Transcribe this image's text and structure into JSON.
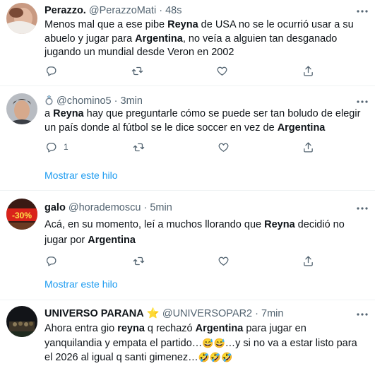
{
  "tweets": [
    {
      "name": "Perazzo.",
      "handle": "@PerazzoMati",
      "separator": "·",
      "time": "48s",
      "text": [
        "Menos mal que a ese pibe ",
        "Reyna",
        " de USA no se le ocurrió usar a su abuelo y jugar para ",
        "Argentina",
        ", no veía a alguien tan desganado jugando un mundial desde Veron en 2002"
      ],
      "reply_count": "",
      "show_thread": ""
    },
    {
      "name": "",
      "badge_icon": "ring-icon",
      "handle": "@chomino5",
      "separator": "·",
      "time": "3min",
      "text": [
        "a ",
        "Reyna",
        " hay que preguntarle cómo se puede ser tan boludo de elegir un país donde al fútbol se le dice soccer en vez de ",
        "Argentina"
      ],
      "reply_count": "1",
      "show_thread": "Mostrar este hilo"
    },
    {
      "name": "galo",
      "handle": "@horademoscu",
      "separator": "·",
      "time": "5min",
      "text": [
        "Acá, en su momento, leí a muchos llorando que ",
        "Reyna",
        " decidió no jugar por ",
        "Argentina"
      ],
      "reply_count": "",
      "show_thread": "Mostrar este hilo",
      "avatar_text": "-30%"
    },
    {
      "name": "UNIVERSO PARANA",
      "name_emoji": "⭐",
      "handle": "@UNIVERSOPAR2",
      "separator": "·",
      "time": "7min",
      "text": [
        "Ahora entra gio ",
        "reyna",
        " q rechazó ",
        "Argentina",
        " para jugar en yanquilandia y empata el partido…",
        "😅😅",
        "…y si no va a estar listo para el 2026 al igual q santi gimenez…",
        "🤣🤣🤣"
      ],
      "reply_count": "",
      "show_thread": ""
    }
  ],
  "more_icon": "more-horizontal-icon",
  "action_icons": [
    "reply-icon",
    "retweet-icon",
    "like-icon",
    "share-icon"
  ],
  "colors": {
    "text": "#0f1419",
    "secondary": "#536471",
    "link": "#1d9bf0",
    "divider": "#eff3f4"
  }
}
